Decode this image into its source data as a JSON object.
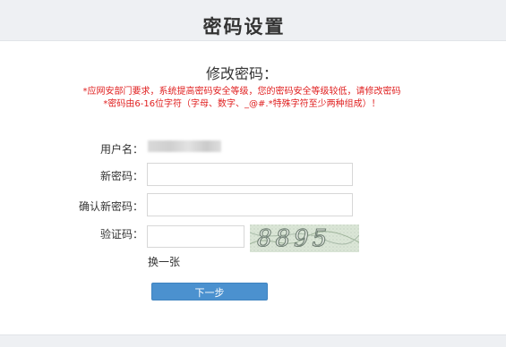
{
  "header": {
    "title": "密码设置"
  },
  "form": {
    "section_title": "修改密码：",
    "notice_line1": "*应网安部门要求，系统提高密码安全等级，您的密码安全等级较低，请修改密码",
    "notice_line2": "*密码由6-16位字符（字母、数字、_@#.*特殊字符至少两种组成）！",
    "username_label": "用户名：",
    "new_password_label": "新密码：",
    "new_password_value": "",
    "confirm_password_label": "确认新密码：",
    "confirm_password_value": "",
    "captcha_label": "验证码：",
    "captcha_value": "",
    "captcha_image_text": "8895",
    "refresh_captcha_label": "换一张",
    "next_button_label": "下一步"
  },
  "colors": {
    "notice": "#e02020",
    "button": "#4b91cf",
    "header_bg": "#eef0f3"
  }
}
